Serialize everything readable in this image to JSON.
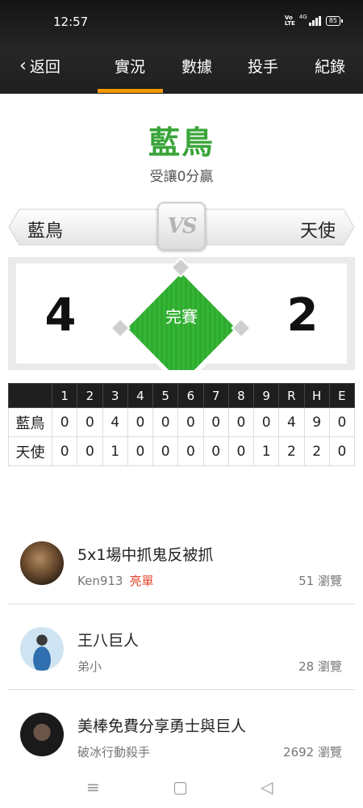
{
  "status_bar": {
    "time": "12:57",
    "volte": "Vo LTE",
    "network": "4G",
    "battery": "85"
  },
  "nav": {
    "back_label": "返回",
    "tabs": [
      {
        "label": "實況",
        "active": true
      },
      {
        "label": "數據"
      },
      {
        "label": "投手"
      },
      {
        "label": "紀錄"
      }
    ]
  },
  "game": {
    "winner": "藍鳥",
    "subtitle": "受讓0分贏",
    "away_team": "藍鳥",
    "home_team": "天使",
    "vs_label": "VS",
    "away_score": "4",
    "home_score": "2",
    "status": "完賽"
  },
  "linescore": {
    "headers": [
      "",
      "1",
      "2",
      "3",
      "4",
      "5",
      "6",
      "7",
      "8",
      "9",
      "R",
      "H",
      "E"
    ],
    "rows": [
      [
        "藍鳥",
        "0",
        "0",
        "4",
        "0",
        "0",
        "0",
        "0",
        "0",
        "0",
        "4",
        "9",
        "0"
      ],
      [
        "天使",
        "0",
        "0",
        "1",
        "0",
        "0",
        "0",
        "0",
        "0",
        "1",
        "2",
        "2",
        "0"
      ]
    ]
  },
  "posts": [
    {
      "title": "5x1場中抓鬼反被抓",
      "author": "Ken913",
      "badge": "亮單",
      "views": "51 瀏覽"
    },
    {
      "title": "王八巨人",
      "author": "弟小",
      "views": "28 瀏覽"
    },
    {
      "title": "美棒免費分享勇士與巨人",
      "author": "破冰行動殺手",
      "views": "2692 瀏覽"
    }
  ],
  "colors": {
    "accent": "#f39800",
    "green": "#3aa53a",
    "badge_red": "#e8462a",
    "header_bg": "#1f1f1f"
  },
  "system_nav": {
    "menu_icon": "≡",
    "home_icon": "▢",
    "back_icon": "◁"
  }
}
